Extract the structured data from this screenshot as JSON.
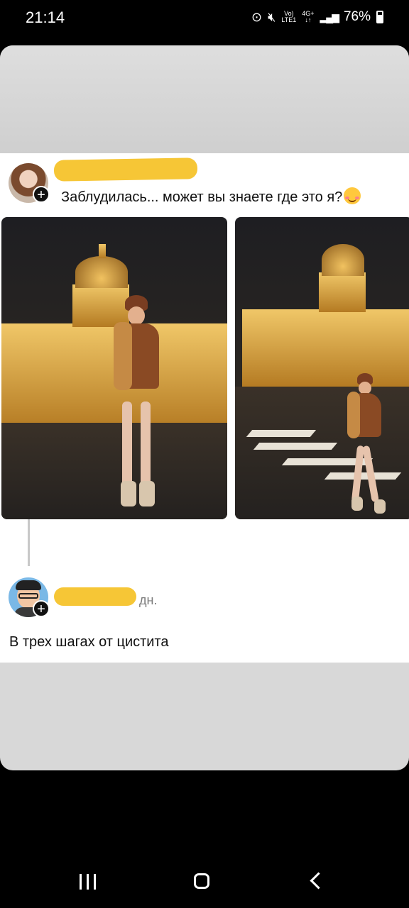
{
  "status_bar": {
    "time": "21:14",
    "network_top": "Vo)",
    "network_bottom": "LTE1",
    "signal_type_top": "4G+",
    "battery": "76%"
  },
  "post": {
    "caption": "Заблудилась... может вы знаете где это я?",
    "photos": [
      "night-photo-cathedral-woman",
      "night-photo-cathedral-crosswalk"
    ]
  },
  "reply": {
    "time_suffix": "дн.",
    "text": "В трех шагах от цистита"
  },
  "colors": {
    "redaction": "#f6c636",
    "background": "#000000",
    "card": "#ffffff"
  }
}
